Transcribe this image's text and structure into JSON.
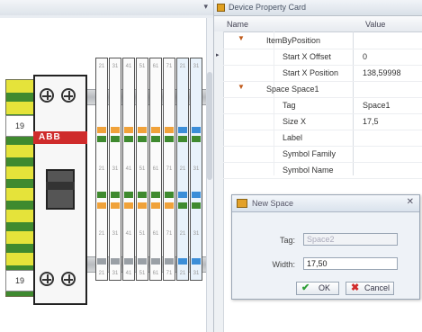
{
  "panel": {
    "title": "Device Property Card",
    "columns": {
      "name": "Name",
      "value": "Value"
    },
    "rows": [
      {
        "type": "group",
        "name": "ItemByPosition"
      },
      {
        "type": "prop",
        "name": "Start X Offset",
        "value": "0"
      },
      {
        "type": "prop",
        "name": "Start X Position",
        "value": "138,59998"
      },
      {
        "type": "group",
        "name": "Space Space1"
      },
      {
        "type": "prop",
        "name": "Tag",
        "value": "Space1"
      },
      {
        "type": "prop",
        "name": "Size X",
        "value": "17,5"
      },
      {
        "type": "prop",
        "name": "Label",
        "value": ""
      },
      {
        "type": "prop",
        "name": "Symbol Family",
        "value": ""
      },
      {
        "type": "prop",
        "name": "Symbol Name",
        "value": ""
      }
    ]
  },
  "canvas": {
    "brand": "ABB",
    "pe_labels": [
      "19",
      "19"
    ],
    "terminal_numbers": [
      "21",
      "31",
      "41",
      "51",
      "61",
      "71"
    ]
  },
  "dialog": {
    "title": "New Space",
    "tag_label": "Tag:",
    "tag_value": "Space2",
    "width_label": "Width:",
    "width_value": "17,50",
    "ok_label": "OK",
    "cancel_label": "Cancel"
  },
  "colors": {
    "accent": "#e2a12a",
    "brand_red": "#cf2b2b",
    "terminal_blue": "#3b8ed8",
    "terminal_orange": "#f0a23a",
    "terminal_green": "#3f8a2f"
  },
  "icons": [
    "pin-icon",
    "expand-icon",
    "collapse-icon",
    "close-icon",
    "check-icon",
    "cross-icon"
  ]
}
